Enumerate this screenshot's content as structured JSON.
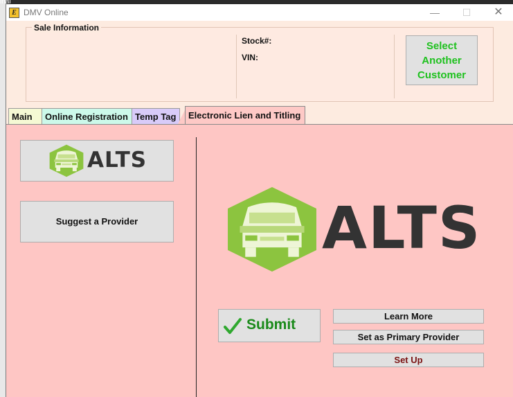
{
  "desktop": {
    "fragment": "inal"
  },
  "window": {
    "title": "DMV Online",
    "icon_letters": "E",
    "controls": {
      "minimize": "—",
      "maximize": "☐",
      "close": "✕"
    }
  },
  "sale_info": {
    "title": "Sale Information",
    "stock_label": "Stock#:",
    "vin_label": "VIN:",
    "select_customer_label": "Select\nAnother\nCustomer"
  },
  "tabs": [
    {
      "label": "Main"
    },
    {
      "label": "Online Registration"
    },
    {
      "label": "Temp Tag"
    },
    {
      "label": "Electronic Lien and Titling",
      "active": true
    }
  ],
  "elt_panel": {
    "logo_word": "ALTS",
    "suggest_label": "Suggest a Provider",
    "submit_label": "Submit",
    "learn_more_label": "Learn More",
    "primary_label": "Set as Primary Provider",
    "setup_label": "Set Up"
  },
  "colors": {
    "logo_green": "#8cc43f",
    "logo_text": "#333333",
    "select_text": "#1ec11e",
    "submit_text": "#1a8a1a",
    "setup_text": "#7a1212",
    "panel_bg": "#fec6c4",
    "window_bg": "#fdebe0"
  },
  "icons": {
    "check": "check-icon",
    "car_logo": "car-hexagon-icon"
  }
}
